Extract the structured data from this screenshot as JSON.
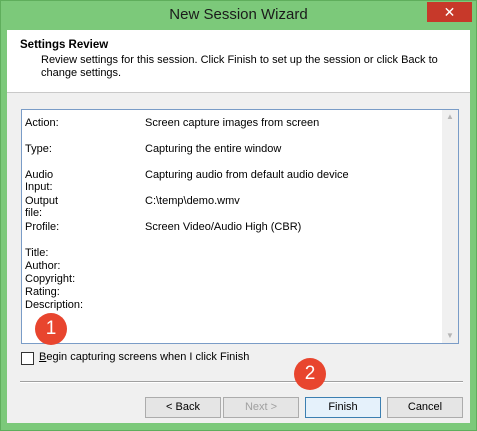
{
  "window": {
    "title": "New Session Wizard",
    "close_glyph": "✕"
  },
  "header": {
    "title": "Settings Review",
    "description": "Review settings for this session. Click Finish to set up the session or click Back to change settings."
  },
  "review": {
    "rows": [
      {
        "label": "Action:",
        "value": "Screen capture images from screen"
      },
      {
        "label": "Type:",
        "value": "Capturing the entire window"
      },
      {
        "label": "Audio Input:",
        "value": "Capturing audio from default audio device"
      },
      {
        "label": "Output file:",
        "value": "C:\\temp\\demo.wmv"
      },
      {
        "label": "Profile:",
        "value": "Screen Video/Audio High (CBR)"
      }
    ],
    "meta_labels": [
      "Title:",
      "Author:",
      "Copyright:",
      "Rating:",
      "Description:"
    ]
  },
  "checkbox": {
    "label_prefix": "B",
    "label_rest": "egin capturing screens when I click Finish",
    "checked": false
  },
  "buttons": {
    "back": "< Back",
    "next": "Next >",
    "finish": "Finish",
    "cancel": "Cancel"
  },
  "badges": {
    "one": "1",
    "two": "2"
  },
  "colors": {
    "titlebar": "#7cc97a",
    "close": "#c7392a",
    "badge": "#e8452e",
    "review_border": "#7a9cc7"
  }
}
